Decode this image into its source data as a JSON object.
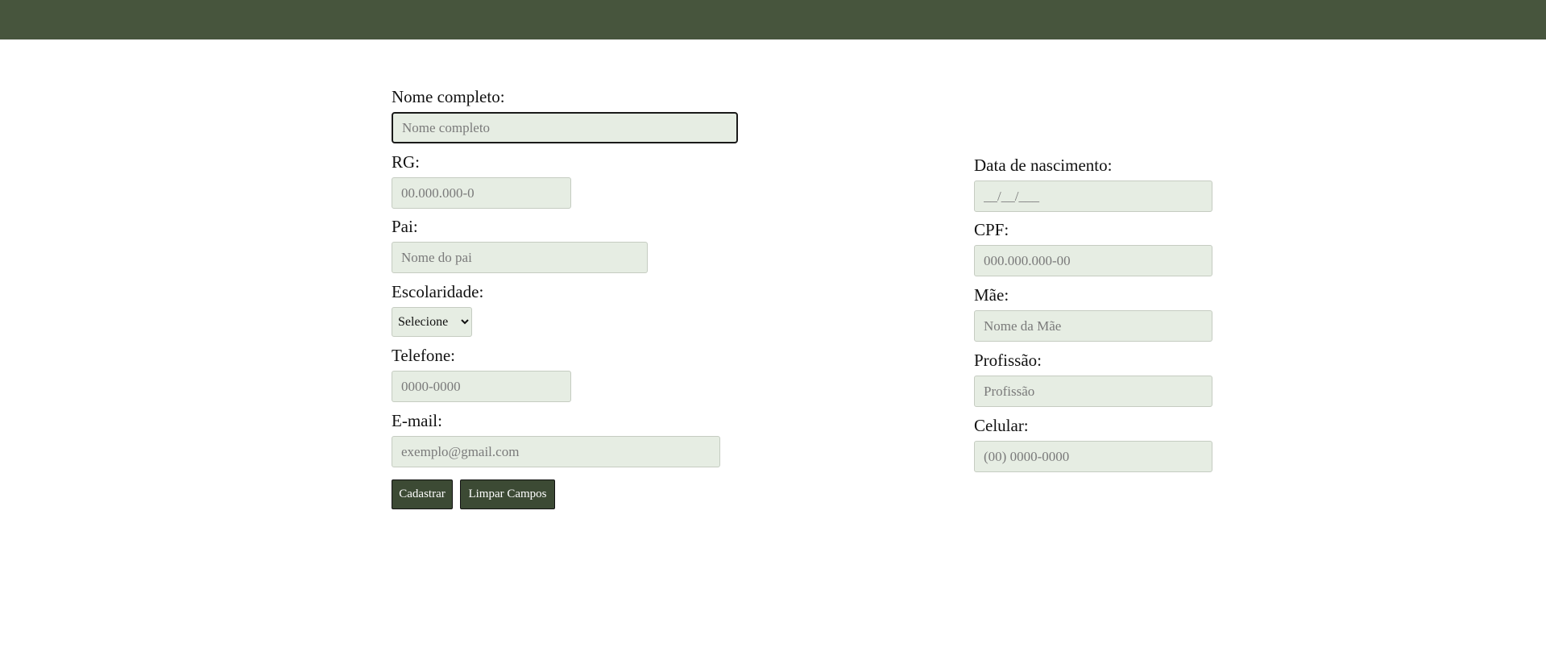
{
  "form": {
    "nome": {
      "label": "Nome completo:",
      "placeholder": "Nome completo",
      "value": ""
    },
    "rg": {
      "label": "RG:",
      "placeholder": "00.000.000-0",
      "value": ""
    },
    "pai": {
      "label": "Pai:",
      "placeholder": "Nome do pai",
      "value": ""
    },
    "escolaridade": {
      "label": "Escolaridade:",
      "selected": "Selecione"
    },
    "telefone": {
      "label": "Telefone:",
      "placeholder": "0000-0000",
      "value": ""
    },
    "email": {
      "label": "E-mail:",
      "placeholder": "exemplo@gmail.com",
      "value": ""
    },
    "nascimento": {
      "label": "Data de nascimento:",
      "placeholder": "__/__/___",
      "value": ""
    },
    "cpf": {
      "label": "CPF:",
      "placeholder": "000.000.000-00",
      "value": ""
    },
    "mae": {
      "label": "Mãe:",
      "placeholder": "Nome da Mãe",
      "value": ""
    },
    "profissao": {
      "label": "Profissão:",
      "placeholder": "Profissão",
      "value": ""
    },
    "celular": {
      "label": "Celular:",
      "placeholder": "(00) 0000-0000",
      "value": ""
    }
  },
  "buttons": {
    "cadastrar": "Cadastrar",
    "limpar": "Limpar Campos"
  },
  "colors": {
    "header": "#47553d",
    "input_bg": "#e6ede3",
    "button_bg": "#3c4a34"
  }
}
